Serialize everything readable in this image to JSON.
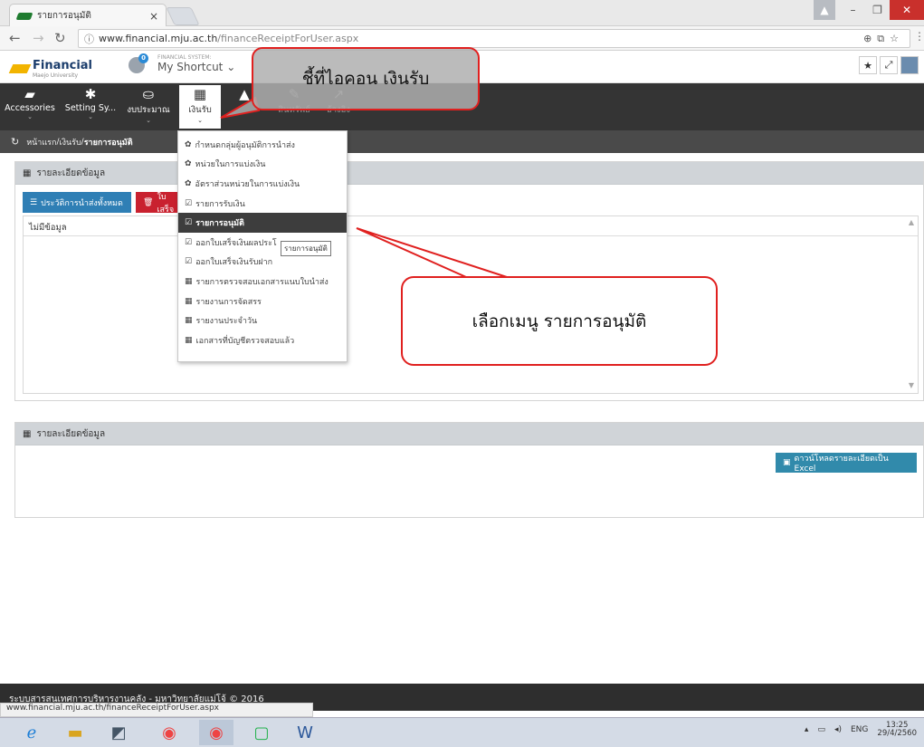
{
  "browser": {
    "tab_title": "รายการอนุมัติ",
    "tab_close": "×",
    "url_host": "www.financial.mju.ac.th",
    "url_path": "/financeReceiptForUser.aspx",
    "info_icon": "ⓘ",
    "status_url": "www.financial.mju.ac.th/financeReceiptForUser.aspx"
  },
  "header": {
    "logo_text": "Financial",
    "logo_sub": "Maejo University",
    "notif_count": "0",
    "system_label": "FINANCIAL SYSTEM:",
    "shortcut_label": "My Shortcut ⌄"
  },
  "menu": [
    {
      "label": "Accessories",
      "icon": "▰"
    },
    {
      "label": "Setting Sy...",
      "icon": "✱"
    },
    {
      "label": "งบประมาณ",
      "icon": "⛀"
    },
    {
      "label": "เงินรับ",
      "icon": "▦"
    },
    {
      "label": "",
      "icon": "▲"
    },
    {
      "label": "สินทรัพย์",
      "icon": "✎"
    },
    {
      "label": "อ้างอิง",
      "icon": "↗"
    }
  ],
  "breadcrumb": {
    "home": "หน้าแรก",
    "sep": " / ",
    "section": "เงินรับ",
    "current": "รายการอนุมัติ"
  },
  "panel1": {
    "title": "รายละเอียดข้อมูล",
    "btn_history": "ประวัติการนำส่งทั้งหมด",
    "btn_receipt": "ใบเสร็จ",
    "no_data": "ไม่มีข้อมูล"
  },
  "panel2": {
    "title": "รายละเอียดข้อมูล",
    "btn_excel": "ดาวน์โหลดรายละเอียดเป็น Excel"
  },
  "dropdown": [
    {
      "icon": "✿",
      "label": "กำหนดกลุ่มผู้อนุมัติการนำส่ง"
    },
    {
      "icon": "✿",
      "label": "หน่วยในการแบ่งเงิน"
    },
    {
      "icon": "✿",
      "label": "อัตราส่วนหน่วยในการแบ่งเงิน"
    },
    {
      "icon": "☑",
      "label": "รายการรับเงิน"
    },
    {
      "icon": "☑",
      "label": "รายการอนุมัติ"
    },
    {
      "icon": "☑",
      "label": "ออกใบเสร็จเงินผลประโ"
    },
    {
      "icon": "☑",
      "label": "ออกใบเสร็จเงินรับฝาก"
    },
    {
      "icon": "▦",
      "label": "รายการตรวจสอบเอกสารแนบใบนำส่ง"
    },
    {
      "icon": "▦",
      "label": "รายงานการจัดสรร"
    },
    {
      "icon": "▦",
      "label": "รายงานประจำวัน"
    },
    {
      "icon": "▦",
      "label": "เอกสารที่บัญชีตรวจสอบแล้ว"
    }
  ],
  "tooltip": "รายการอนุมัติ",
  "callouts": {
    "top": "ชี้ที่ไอคอน เงินรับ",
    "right": "เลือกเมนู รายการอนุมัติ"
  },
  "footer": "ระบบสารสนเทศการบริหารงานคลัง - มหาวิทยาลัยแม่โจ้ © 2016",
  "taskbar": {
    "lang": "ENG",
    "time": "13:25",
    "date": "29/4/2560"
  },
  "colors": {
    "callout_border": "#e0201f",
    "menubar": "#343434",
    "btn_blue": "#2f7fb5",
    "btn_red": "#c9212f"
  }
}
